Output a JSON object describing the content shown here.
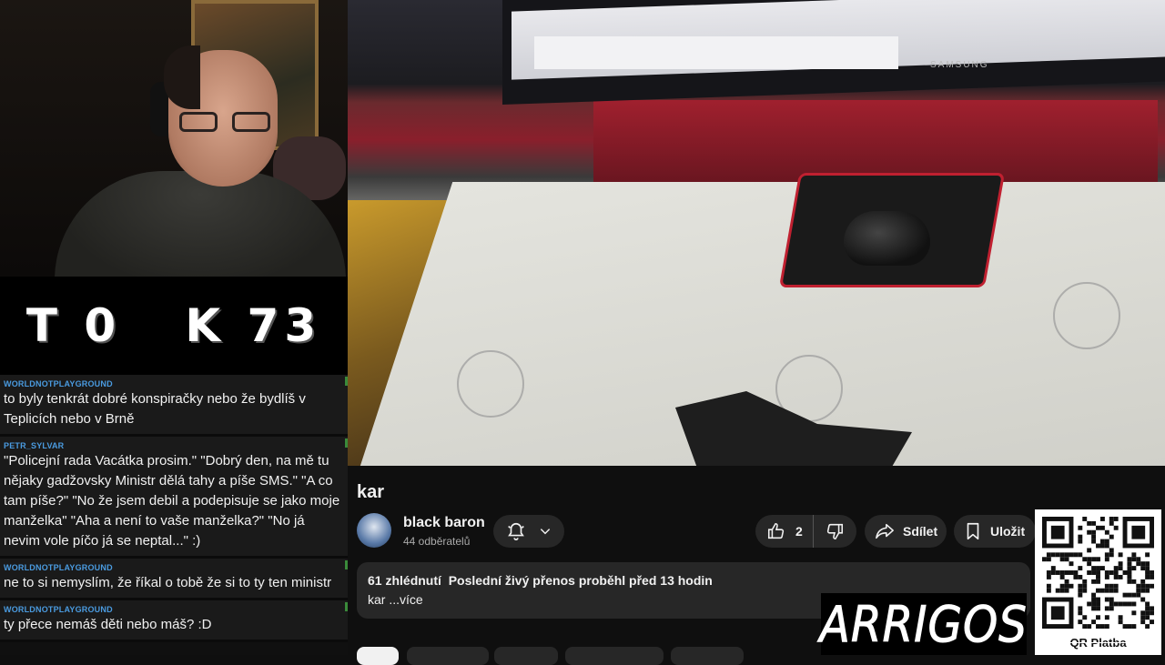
{
  "overlay_counter": "T 0   K 73",
  "chat": {
    "messages": [
      {
        "user": "WORLDNOTPLAYGROUND",
        "text": "to byly tenkrát dobré konspiračky nebo že bydlíš v Teplicích nebo v Brně"
      },
      {
        "user": "PETR_SYLVAR",
        "text": "\"Policejní rada Vacátka prosim.\" \"Dobrý den, na mě tu nějaky gadžovsky Ministr dělá tahy a píše SMS.\" \"A co tam píše?\" \"No že jsem debil a podepisuje se jako moje manželka\" \"Aha a není to vaše manželka?\" \"No já nevim vole píčo já se neptal...\" :)"
      },
      {
        "user": "WORLDNOTPLAYGROUND",
        "text": "ne to si nemyslím, že říkal o tobě že si to ty ten ministr"
      },
      {
        "user": "WORLDNOTPLAYGROUND",
        "text": "ty přece nemáš děti nebo máš? :D"
      }
    ]
  },
  "video": {
    "title": "kar",
    "screen_brand": "SAMSUNG"
  },
  "channel": {
    "name": "black baron",
    "subscribers": "44 odběratelů"
  },
  "actions": {
    "like_count": "2",
    "share_label": "Sdílet",
    "save_label": "Uložit"
  },
  "description": {
    "views": "61 zhlédnutí",
    "stream_info": "Poslední živý přenos proběhl před 13 hodin",
    "text": "kar",
    "more_label": "...více"
  },
  "overlays": {
    "logo_text": "ARRIGOS",
    "qr_caption": "QR Platba"
  },
  "colors": {
    "background": "#0f0f0f",
    "chat_username": "#4a9be0",
    "pill": "#272727"
  }
}
